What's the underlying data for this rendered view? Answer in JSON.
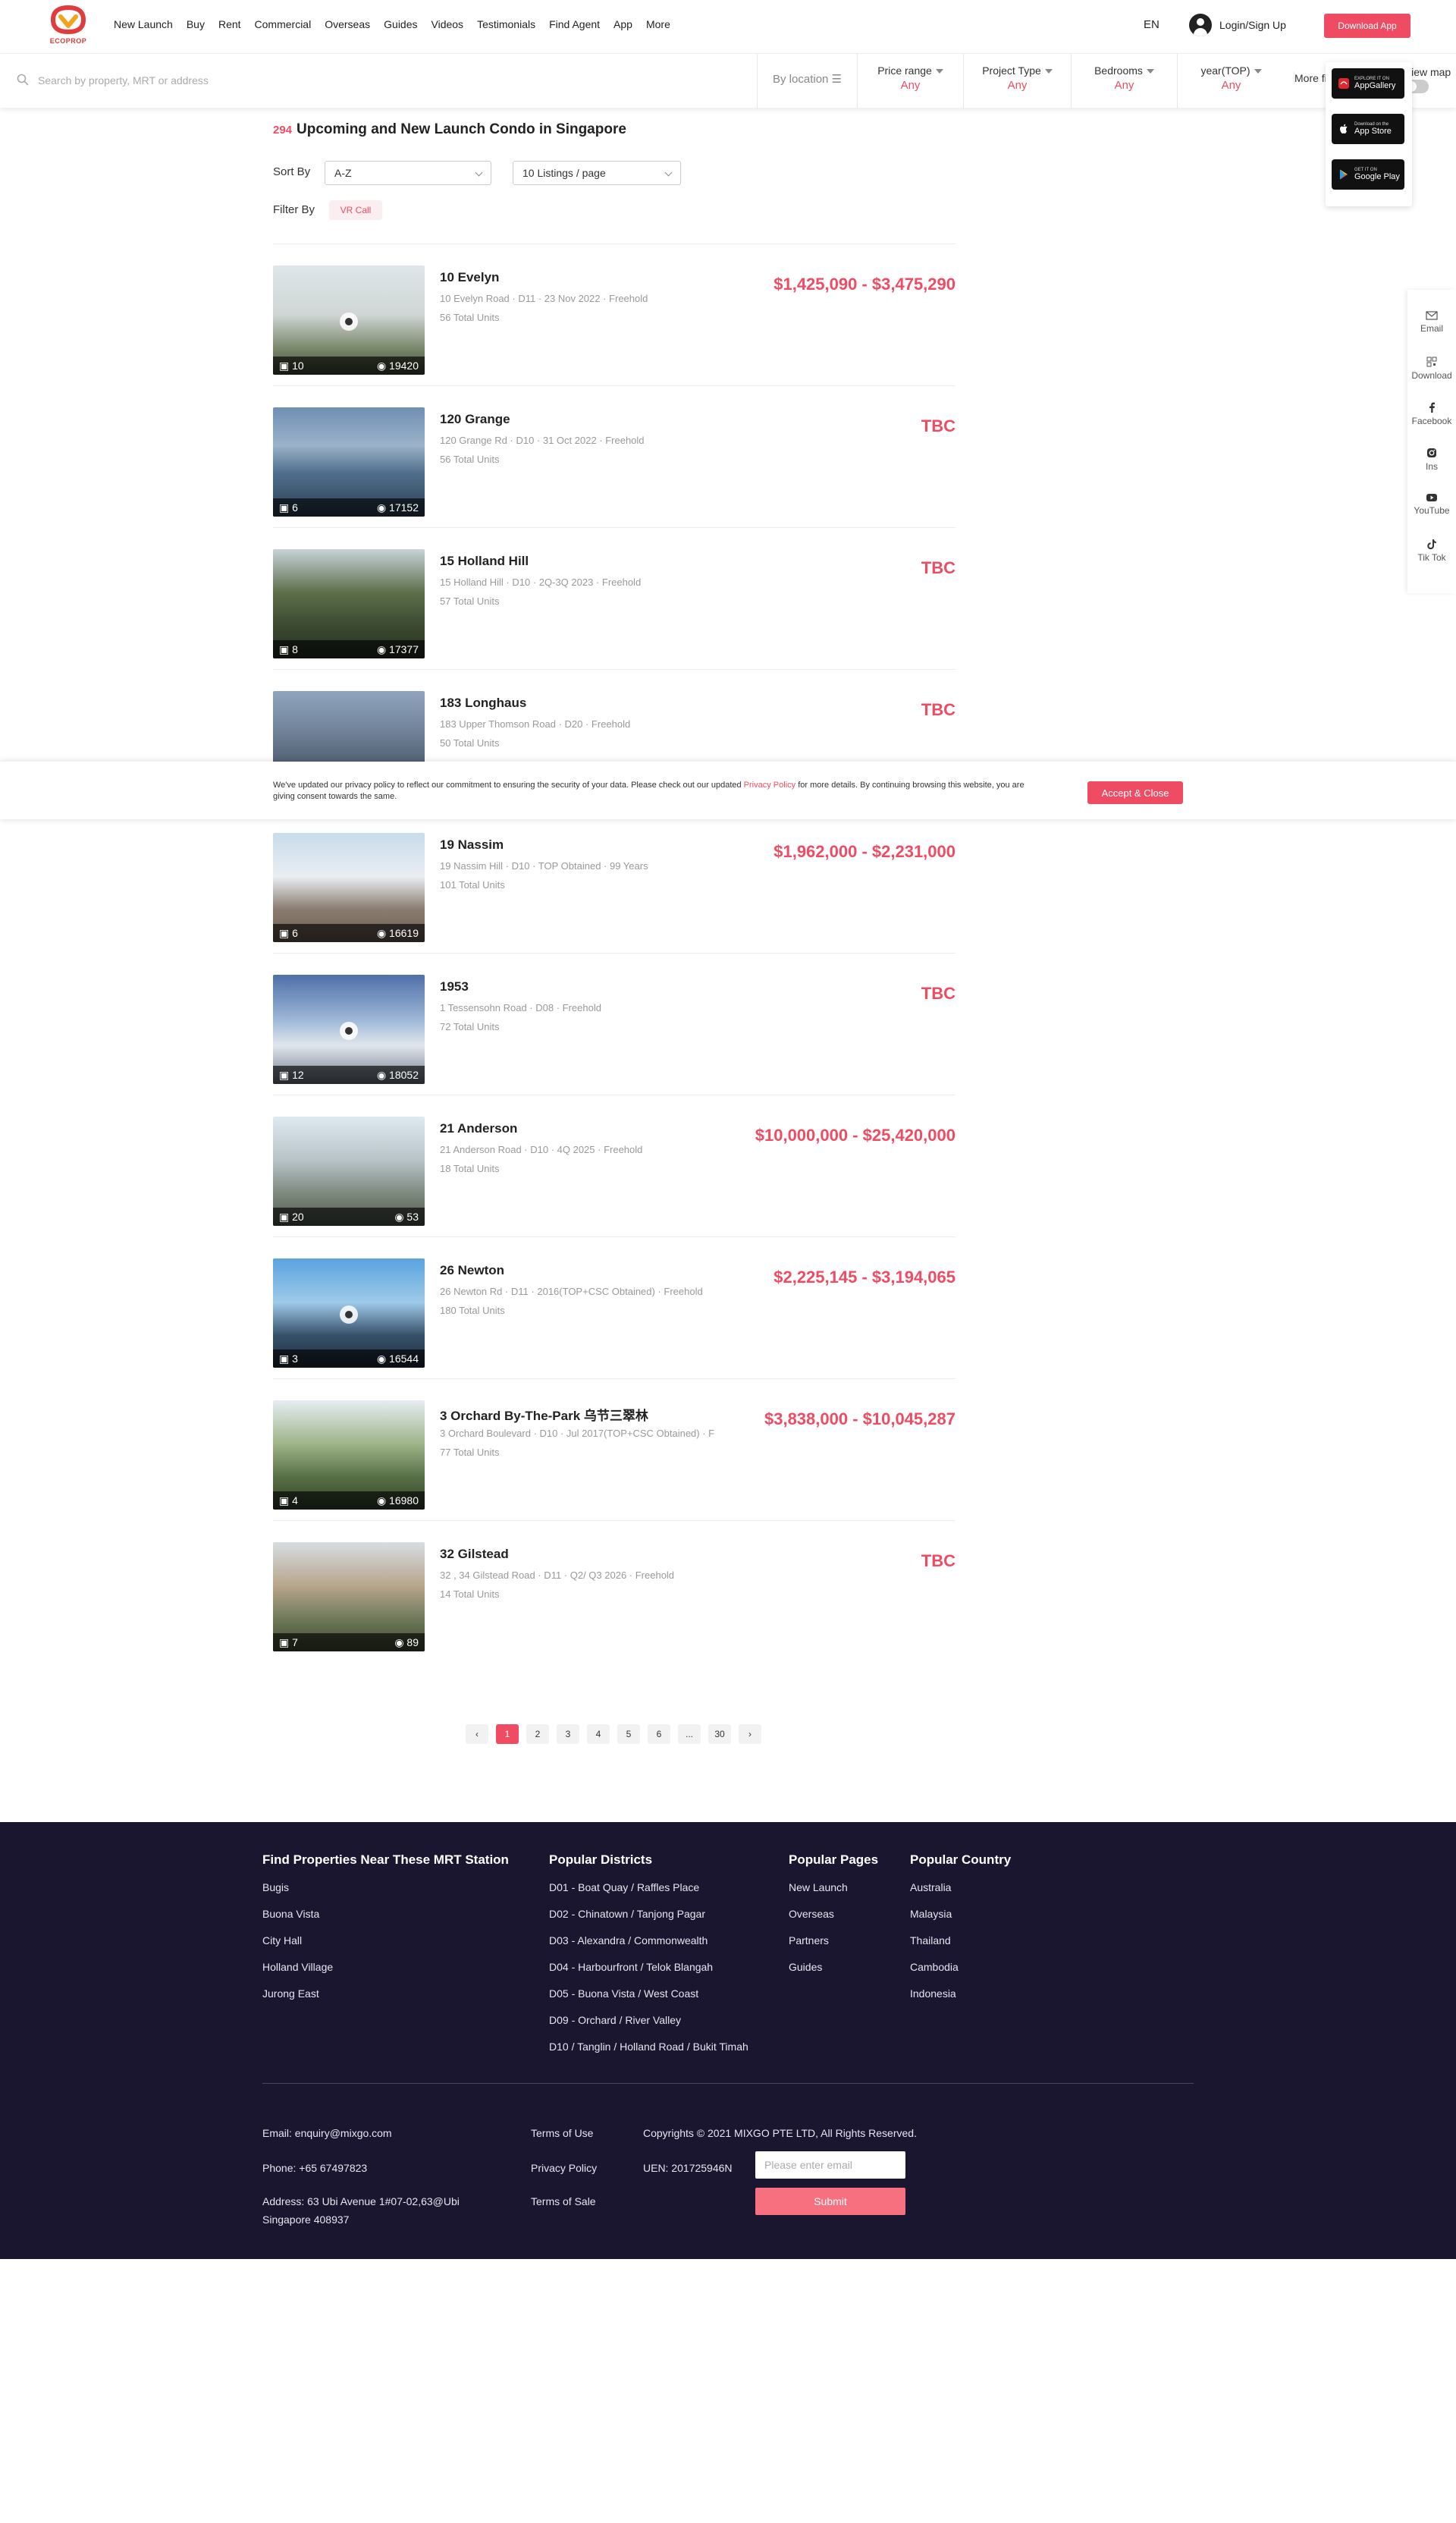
{
  "header": {
    "logo_text": "ECOPROP",
    "nav": [
      "New Launch",
      "Buy",
      "Rent",
      "Commercial",
      "Overseas",
      "Guides",
      "Videos",
      "Testimonials",
      "Find Agent",
      "App",
      "More"
    ],
    "lang": "EN",
    "login": "Login/Sign Up",
    "download": "Download App"
  },
  "search": {
    "placeholder": "Search by property, MRT or address",
    "by_location": "By location",
    "filters": [
      {
        "label": "Price range",
        "value": "Any"
      },
      {
        "label": "Project Type",
        "value": "Any"
      },
      {
        "label": "Bedrooms",
        "value": "Any"
      },
      {
        "label": "year(TOP)",
        "value": "Any"
      }
    ],
    "more_filters": "More filters",
    "view_map": "View map"
  },
  "app_popover": {
    "stores": [
      {
        "small": "EXPLORE IT ON",
        "big": "AppGallery"
      },
      {
        "small": "Download on the",
        "big": "App Store"
      },
      {
        "small": "GET IT ON",
        "big": "Google Play"
      }
    ]
  },
  "rail": [
    "Email",
    "Download",
    "Facebook",
    "Ins",
    "YouTube",
    "Tik Tok"
  ],
  "main": {
    "count": "294",
    "title": "Upcoming and New Launch Condo in Singapore",
    "sort_label": "Sort By",
    "sort_value": "A-Z",
    "per_page": "10 Listings / page",
    "filter_label": "Filter By",
    "vr_tag": "VR Call"
  },
  "listings": [
    {
      "name": "10 Evelyn",
      "meta": "10 Evelyn Road · D11 · 23 Nov 2022 · Freehold",
      "units": "56 Total Units",
      "price": "$1,425,090 - $3,475,290",
      "photos": "10",
      "views": "19420",
      "vr": true
    },
    {
      "name": "120 Grange",
      "meta": "120 Grange Rd · D10 · 31 Oct 2022 · Freehold",
      "units": "56 Total Units",
      "price": "TBC",
      "photos": "6",
      "views": "17152",
      "vr": false
    },
    {
      "name": "15 Holland Hill",
      "meta": "15 Holland Hill · D10 · 2Q-3Q 2023 · Freehold",
      "units": "57 Total Units",
      "price": "TBC",
      "photos": "8",
      "views": "17377",
      "vr": false
    },
    {
      "name": "183 Longhaus",
      "meta": "183 Upper Thomson Road · D20 · Freehold",
      "units": "50 Total Units",
      "price": "TBC",
      "photos": "",
      "views": "",
      "vr": false
    },
    {
      "name": "19 Nassim",
      "meta": "19 Nassim Hill · D10 · TOP Obtained · 99 Years",
      "units": "101 Total Units",
      "price": "$1,962,000 - $2,231,000",
      "photos": "6",
      "views": "16619",
      "vr": false
    },
    {
      "name": "1953",
      "meta": "1 Tessensohn Road · D08 · Freehold",
      "units": "72 Total Units",
      "price": "TBC",
      "photos": "12",
      "views": "18052",
      "vr": true
    },
    {
      "name": "21 Anderson",
      "meta": "21 Anderson Road · D10 · 4Q 2025 · Freehold",
      "units": "18 Total Units",
      "price": "$10,000,000 - $25,420,000",
      "photos": "20",
      "views": "53",
      "vr": false
    },
    {
      "name": "26 Newton",
      "meta": "26 Newton Rd · D11 · 2016(TOP+CSC Obtained) · Freehold",
      "units": "180 Total Units",
      "price": "$2,225,145 - $3,194,065",
      "photos": "3",
      "views": "16544",
      "vr": true
    },
    {
      "name": "3 Orchard By-The-Park 乌节三翠林",
      "meta": "3 Orchard Boulevard · D10 · Jul 2017(TOP+CSC Obtained) · F",
      "units": "77 Total Units",
      "price": "$3,838,000 - $10,045,287",
      "photos": "4",
      "views": "16980",
      "vr": false
    },
    {
      "name": "32 Gilstead",
      "meta": "32 , 34 Gilstead Road · D11 · Q2/ Q3 2026 · Freehold",
      "units": "14 Total Units",
      "price": "TBC",
      "photos": "7",
      "views": "89",
      "vr": false
    }
  ],
  "cookie": {
    "text_before": "We've updated our privacy policy to reflect our commitment to ensuring the security of your data. Please check out our updated ",
    "link": "Privacy Policy",
    "text_after": " for more details. By continuing browsing this website, you are giving consent towards the same.",
    "button": "Accept & Close"
  },
  "pagination": {
    "prev": "‹",
    "pages": [
      "1",
      "2",
      "3",
      "4",
      "5",
      "6",
      "...",
      "30"
    ],
    "next": "›",
    "current": "1"
  },
  "footer": {
    "mrt": {
      "title": "Find Properties Near These MRT Station",
      "items": [
        "Bugis",
        "Buona Vista",
        "City Hall",
        "Holland Village",
        "Jurong East"
      ]
    },
    "districts": {
      "title": "Popular Districts",
      "items": [
        "D01 - Boat Quay / Raffles Place",
        "D02 - Chinatown / Tanjong Pagar",
        "D03 - Alexandra / Commonwealth",
        "D04 - Harbourfront / Telok Blangah",
        "D05 - Buona Vista / West Coast",
        "D09 - Orchard / River Valley",
        "D10 / Tanglin / Holland Road / Bukit Timah"
      ]
    },
    "pages": {
      "title": "Popular Pages",
      "items": [
        "New Launch",
        "Overseas",
        "Partners",
        "Guides"
      ]
    },
    "country": {
      "title": "Popular Country",
      "items": [
        "Australia",
        "Malaysia",
        "Thailand",
        "Cambodia",
        "Indonesia"
      ]
    },
    "email": "Email: enquiry@mixgo.com",
    "phone": "Phone: +65 67497823",
    "address": "Address: 63 Ubi Avenue 1#07-02,63@Ubi Singapore 408937",
    "terms_use": "Terms of Use",
    "privacy": "Privacy Policy",
    "terms_sale": "Terms of Sale",
    "copyright": "Copyrights © 2021 MIXGO PTE LTD, All Rights Reserved.",
    "uen": "UEN: 201725946N",
    "email_placeholder": "Please enter email",
    "submit": "Submit"
  },
  "colors": {
    "accent": "#ef4c63",
    "footer_bg": "#1b1630"
  }
}
